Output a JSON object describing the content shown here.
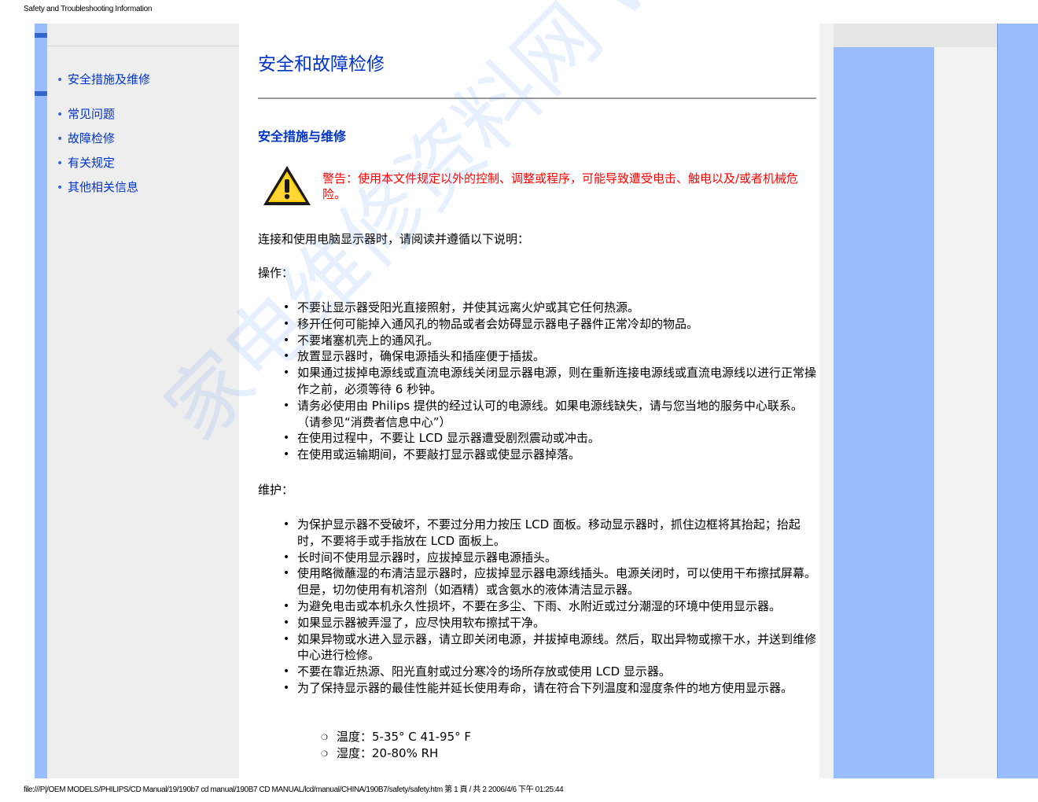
{
  "print_header": "Safety and Troubleshooting Information",
  "print_footer": "file:///P|/OEM MODELS/PHILIPS/CD Manual/19/190b7 cd manual/190B7 CD MANUAL/lcd/manual/CHINA/190B7/safety/safety.htm 第 1 頁 / 共 2 2006/4/6 下午 01:25:44",
  "watermark": "家电维修资料网 www.52010.com",
  "nav": {
    "items": [
      {
        "label": "安全措施及维修"
      },
      {
        "label": "常见问题"
      },
      {
        "label": "故障检修"
      },
      {
        "label": "有关规定"
      },
      {
        "label": "其他相关信息"
      }
    ]
  },
  "main": {
    "title": "安全和故障检修",
    "section_title": "安全措施与维修",
    "warning": "警告：使用本文件规定以外的控制、调整或程序，可能导致遭受电击、触电以及/或者机械危险。",
    "intro": "连接和使用电脑显示器时，请阅读并遵循以下说明：",
    "operation_heading": "操作：",
    "operation_items": [
      "不要让显示器受阳光直接照射，并使其远离火炉或其它任何热源。",
      "移开任何可能掉入通风孔的物品或者会妨碍显示器电子器件正常冷却的物品。",
      "不要堵塞机壳上的通风孔。",
      "放置显示器时，确保电源插头和插座便于插拔。",
      "如果通过拔掉电源线或直流电源线关闭显示器电源，则在重新连接电源线或直流电源线以进行正常操作之前，必须等待 6 秒钟。",
      "请务必使用由 Philips 提供的经过认可的电源线。如果电源线缺失，请与您当地的服务中心联系。（请参见“消费者信息中心”）",
      "在使用过程中，不要让 LCD 显示器遭受剧烈震动或冲击。",
      "在使用或运输期间，不要敲打显示器或使显示器掉落。"
    ],
    "maintenance_heading": "维护：",
    "maintenance_items": [
      "为保护显示器不受破坏，不要过分用力按压 LCD 面板。移动显示器时，抓住边框将其抬起；抬起时，不要将手或手指放在 LCD 面板上。",
      "长时间不使用显示器时，应拔掉显示器电源插头。",
      "使用略微蘸湿的布清洁显示器时，应拔掉显示器电源线插头。电源关闭时，可以使用干布擦拭屏幕。但是，切勿使用有机溶剂（如酒精）或含氨水的液体清洁显示器。",
      "为避免电击或本机永久性损坏，不要在多尘、下雨、水附近或过分潮湿的环境中使用显示器。",
      "如果显示器被弄湿了，应尽快用软布擦拭干净。",
      "如果异物或水进入显示器，请立即关闭电源，并拔掉电源线。然后，取出异物或擦干水，并送到维修中心进行检修。",
      "不要在靠近热源、阳光直射或过分寒冷的场所存放或使用 LCD 显示器。",
      "为了保持显示器的最佳性能并延长使用寿命，请在符合下列温度和湿度条件的地方使用显示器。"
    ],
    "conditions": [
      "温度：5-35° C 41-95° F",
      "湿度：20-80% RH"
    ]
  },
  "colors": {
    "link": "#0033cc",
    "warning": "#ff0000",
    "sidebar_blue": "#99bbff",
    "sidebar_gray": "#eeeeee"
  }
}
